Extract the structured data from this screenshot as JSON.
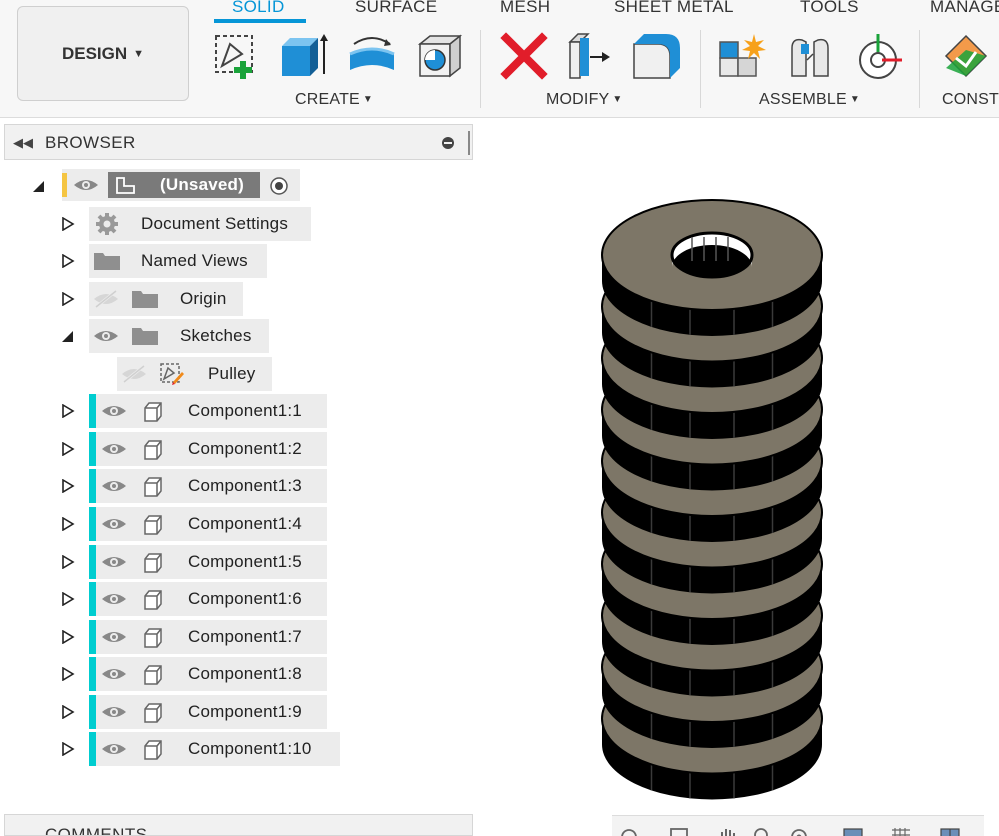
{
  "toolbar": {
    "design_label": "DESIGN",
    "tabs": [
      "SOLID",
      "SURFACE",
      "MESH",
      "SHEET METAL",
      "TOOLS",
      "MANAGE"
    ],
    "active_tab": "SOLID",
    "groups": [
      "CREATE",
      "MODIFY",
      "ASSEMBLE",
      "CONST"
    ],
    "tools": {
      "create": [
        "create-sketch-icon",
        "extrude-icon",
        "revolve-icon",
        "hole-icon"
      ],
      "modify": [
        "delete-icon",
        "press-pull-icon",
        "fillet-icon"
      ],
      "assemble": [
        "new-component-icon",
        "joint-icon",
        "as-built-joint-icon"
      ],
      "construct": [
        "offset-plane-icon"
      ]
    },
    "accent_color": "#0696d7"
  },
  "browser": {
    "title": "BROWSER",
    "root_label": "(Unsaved)",
    "items": [
      {
        "label": "Document Settings"
      },
      {
        "label": "Named Views"
      },
      {
        "label": "Origin"
      },
      {
        "label": "Sketches"
      },
      {
        "label": "Pulley"
      },
      {
        "label": "Component1:1"
      },
      {
        "label": "Component1:2"
      },
      {
        "label": "Component1:3"
      },
      {
        "label": "Component1:4"
      },
      {
        "label": "Component1:5"
      },
      {
        "label": "Component1:6"
      },
      {
        "label": "Component1:7"
      },
      {
        "label": "Component1:8"
      },
      {
        "label": "Component1:9"
      },
      {
        "label": "Component1:10"
      }
    ]
  },
  "comments": {
    "title": "COMMENTS"
  },
  "model": {
    "washer_count": 10,
    "face_color": "#7d7667",
    "side_color": "#000000"
  }
}
